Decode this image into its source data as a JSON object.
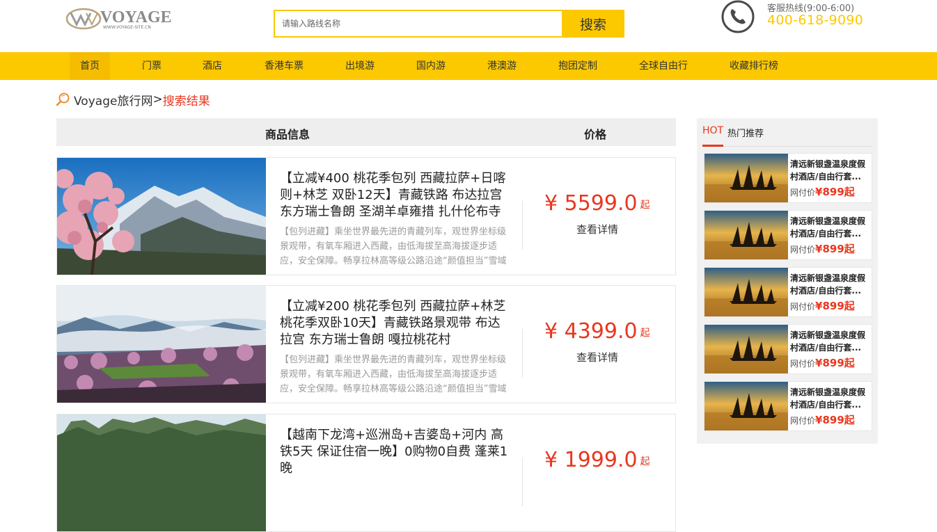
{
  "header": {
    "logo_text": "VOYAGE",
    "logo_sub": "WWW.VOYAGE-SITE.CN",
    "search_placeholder": "请输入路线名称",
    "search_button": "搜索",
    "hotline_label": "客服热线(9:00-6:00)",
    "hotline_number": "400-618-9090"
  },
  "nav": {
    "items": [
      "首页",
      "门票",
      "酒店",
      "香港车票",
      "出境游",
      "国内游",
      "港澳游",
      "抱团定制",
      "全球自由行",
      "收藏排行榜"
    ],
    "active_index": 0
  },
  "breadcrumb": {
    "home": "Voyage旅行网",
    "separator": ">",
    "current": "搜索结果"
  },
  "list": {
    "header_info": "商品信息",
    "header_price": "价格",
    "items": [
      {
        "title": "【立减¥400 桃花季包列 西藏拉萨+日喀则+林芝 双卧12天】青藏铁路 布达拉宫 东方瑞士鲁朗 圣湖羊卓雍措 扎什伦布寺",
        "desc": "【包列进藏】乘坐世界最先进的青藏列车，观世界坐标级景观带，有氧车厢进入西藏，由低海拔至高海拔逐步适应，安全保障。畅享拉林高等级公路沿途“颜值担当”雪域江南风光！",
        "price": "¥ 5599.0",
        "price_suffix": "起",
        "detail": "查看详情"
      },
      {
        "title": "【立减¥200 桃花季包列 西藏拉萨+林芝 桃花季双卧10天】青藏铁路景观带 布达拉宫 东方瑞士鲁朗 嘎拉桃花村",
        "desc": "【包列进藏】乘坐世界最先进的青藏列车，观世界坐标级景观带，有氧车厢进入西藏，由低海拔至高海拔逐步适应，安全保障。畅享拉林高等级公路沿途“颜值担当”雪域江南风光！",
        "price": "¥ 4399.0",
        "price_suffix": "起",
        "detail": "查看详情"
      },
      {
        "title": "【越南下龙湾+巡洲岛+吉婆岛+河内 高铁5天 保证住宿一晚】0购物0自费 蓬莱1晚",
        "desc": "",
        "price": "¥ 1999.0",
        "price_suffix": "起",
        "detail": "查看详情"
      }
    ]
  },
  "sidebar": {
    "hot_label": "HOT",
    "title": "热门推荐",
    "items": [
      {
        "title": "清远新银盏温泉度假村酒店/自由行套...",
        "pay_label": "网付价",
        "price": "¥899起"
      },
      {
        "title": "清远新银盏温泉度假村酒店/自由行套...",
        "pay_label": "网付价",
        "price": "¥899起"
      },
      {
        "title": "清远新银盏温泉度假村酒店/自由行套...",
        "pay_label": "网付价",
        "price": "¥899起"
      },
      {
        "title": "清远新银盏温泉度假村酒店/自由行套...",
        "pay_label": "网付价",
        "price": "¥899起"
      },
      {
        "title": "清远新银盏温泉度假村酒店/自由行套...",
        "pay_label": "网付价",
        "price": "¥899起"
      }
    ]
  },
  "colors": {
    "accent_yellow": "#fcc800",
    "price_red": "#e8371e"
  }
}
